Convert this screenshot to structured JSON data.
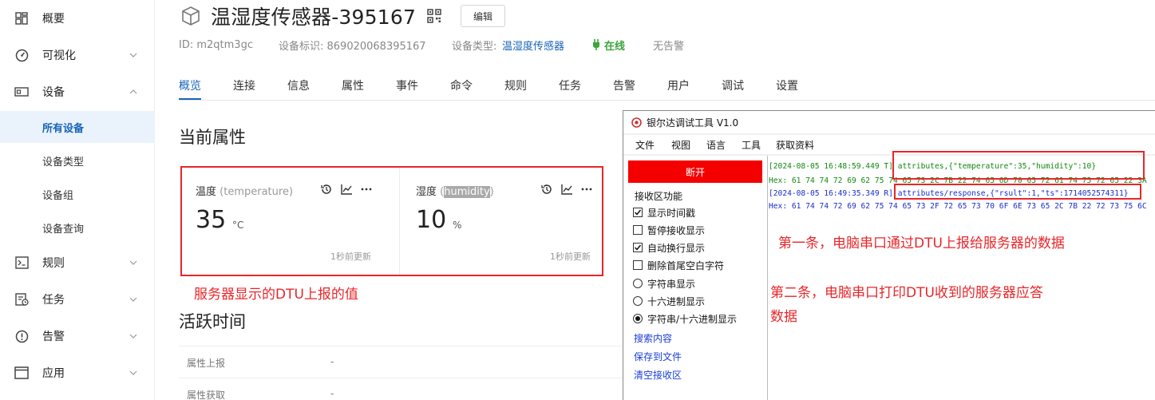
{
  "sidebar": {
    "items": [
      {
        "label": "概要",
        "icon": "dashboard-grid-icon"
      },
      {
        "label": "可视化",
        "icon": "gauge-icon"
      },
      {
        "label": "设备",
        "icon": "device-icon"
      },
      {
        "label": "规则",
        "icon": "terminal-icon"
      },
      {
        "label": "任务",
        "icon": "task-icon"
      },
      {
        "label": "告警",
        "icon": "alert-circle-icon"
      },
      {
        "label": "应用",
        "icon": "window-icon"
      }
    ],
    "sub_items": [
      "所有设备",
      "设备类型",
      "设备组",
      "设备查询"
    ],
    "active_sub": "所有设备"
  },
  "header": {
    "title": "温湿度传感器-395167",
    "edit_label": "编辑",
    "id_text": "ID: m2qtm3gc",
    "ident_label": "设备标识: 869020068395167",
    "type_label": "设备类型:",
    "type_value": "温湿度传感器",
    "status": "在线",
    "alarm": "无告警"
  },
  "tabs": [
    "概览",
    "连接",
    "信息",
    "属性",
    "事件",
    "命令",
    "规则",
    "任务",
    "告警",
    "用户",
    "调试",
    "设置"
  ],
  "active_tab": "概览",
  "properties": {
    "heading": "当前属性",
    "cards": [
      {
        "name": "温度",
        "key": "(temperature)",
        "value": "35",
        "unit": "°C",
        "updated": "1秒前更新"
      },
      {
        "name": "湿度",
        "key_open": "(",
        "key": "humidity",
        "key_close": ")",
        "value": "10",
        "unit": "%",
        "updated": "1秒前更新"
      }
    ]
  },
  "annotations": {
    "server_note": "服务器显示的DTU上报的值",
    "first_note": "第一条，电脑串口通过DTU上报给服务器的数据",
    "second_note_line1": "第二条，电脑串口打印DTU收到的服务器应答",
    "second_note_line2": "数据"
  },
  "activity": {
    "heading": "活跃时间",
    "rows": [
      {
        "label": "属性上报",
        "value": "-"
      },
      {
        "label": "属性获取",
        "value": "-"
      }
    ]
  },
  "serial_tool": {
    "title": "银尔达调试工具 V1.0",
    "menu": [
      "文件",
      "视图",
      "语言",
      "工具",
      "获取资料"
    ],
    "disconnect": "断开",
    "recv_group": "接收区功能",
    "checkboxes": [
      {
        "label": "显示时间戳",
        "checked": true
      },
      {
        "label": "暂停接收显示",
        "checked": false
      },
      {
        "label": "自动换行显示",
        "checked": true
      },
      {
        "label": "删除首尾空白字符",
        "checked": false
      }
    ],
    "radios": [
      {
        "label": "字符串显示",
        "selected": false
      },
      {
        "label": "十六进制显示",
        "selected": false
      },
      {
        "label": "字符串/十六进制显示",
        "selected": true
      }
    ],
    "links": [
      "搜索内容",
      "保存到文件",
      "清空接收区"
    ],
    "log": [
      {
        "ts": "[2024-08-05 16:48:59.449 T]",
        "text": "attributes,{\"temperature\":35,\"humidity\":10}",
        "color": "#118811"
      },
      {
        "ts": "Hex:",
        "text": "61 74 74 72 69 62 75 74 65 73 2C 7B 22 74 65 6D 70 65 72 61 74 75 72 65 22 3A",
        "color": "#118811"
      },
      {
        "ts": "[2024-08-05 16:49:35.349 R]",
        "text": "attributes/response,{\"rsult\":1,\"ts\":1714052574311}",
        "color": "#1a2ecc"
      },
      {
        "ts": "Hex:",
        "text": "61 74 74 72 69 62 75 74 65 73 2F 72 65 73 70 6F 6E 73 65 2C 7B 22 72 73 75 6C",
        "color": "#1a2ecc"
      }
    ]
  }
}
